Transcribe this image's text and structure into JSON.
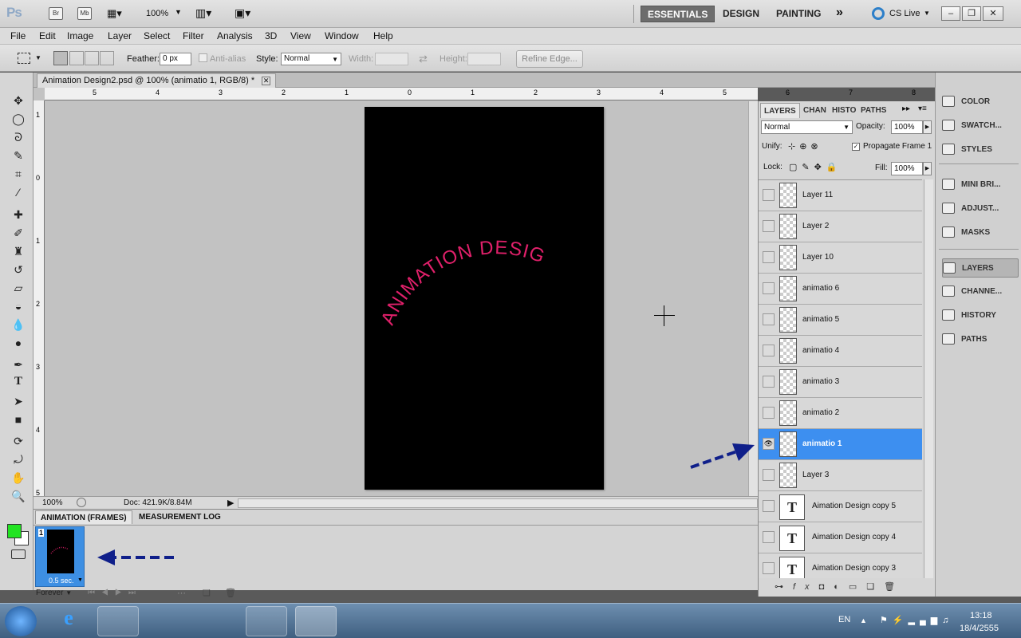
{
  "appbar": {
    "logo": "Ps",
    "bridge": "Br",
    "minibridge": "Mb",
    "zoom": "100%",
    "workspaces": [
      "ESSENTIALS",
      "DESIGN",
      "PAINTING"
    ],
    "more": "»",
    "cslive": "CS Live"
  },
  "menu": [
    "File",
    "Edit",
    "Image",
    "Layer",
    "Select",
    "Filter",
    "Analysis",
    "3D",
    "View",
    "Window",
    "Help"
  ],
  "options": {
    "feather_label": "Feather:",
    "feather_value": "0 px",
    "antialias_label": "Anti-alias",
    "style_label": "Style:",
    "style_value": "Normal",
    "width_label": "Width:",
    "height_label": "Height:",
    "refine_edge": "Refine Edge..."
  },
  "document": {
    "tab_title": "Animation Design2.psd @ 100% (animatio 1, RGB/8) *",
    "artwork_text": "ANIMATION DESIGN",
    "artwork_color": "#e0206a",
    "zoom": "100%",
    "doc_info": "Doc: 421.9K/8.84M",
    "ruler_top": [
      "5",
      "4",
      "3",
      "2",
      "1",
      "0",
      "1",
      "2",
      "3",
      "4",
      "5",
      "6",
      "7",
      "8"
    ],
    "ruler_left": [
      "1",
      "0",
      "1",
      "2",
      "3",
      "4",
      "5"
    ]
  },
  "animation_panel": {
    "tabs": [
      "ANIMATION (FRAMES)",
      "MEASUREMENT LOG"
    ],
    "frame_number": "1",
    "frame_delay": "0.5 sec.",
    "loop": "Forever"
  },
  "layers_panel": {
    "tabs": [
      "LAYERS",
      "CHAN",
      "HISTO",
      "PATHS"
    ],
    "blend_mode": "Normal",
    "opacity_label": "Opacity:",
    "opacity": "100%",
    "unify_label": "Unify:",
    "propagate": "Propagate Frame 1",
    "lock_label": "Lock:",
    "fill_label": "Fill:",
    "fill": "100%",
    "layers": [
      {
        "name": "Layer 11",
        "type": "pixel",
        "visible": false,
        "selected": false
      },
      {
        "name": "Layer 2",
        "type": "pixel",
        "visible": false,
        "selected": false
      },
      {
        "name": "Layer 10",
        "type": "pixel",
        "visible": false,
        "selected": false
      },
      {
        "name": "animatio 6",
        "type": "pixel",
        "visible": false,
        "selected": false
      },
      {
        "name": "animatio 5",
        "type": "pixel",
        "visible": false,
        "selected": false
      },
      {
        "name": "animatio 4",
        "type": "pixel",
        "visible": false,
        "selected": false
      },
      {
        "name": "animatio 3",
        "type": "pixel",
        "visible": false,
        "selected": false
      },
      {
        "name": "animatio 2",
        "type": "pixel",
        "visible": false,
        "selected": false
      },
      {
        "name": "animatio 1",
        "type": "pixel",
        "visible": true,
        "selected": true
      },
      {
        "name": "Layer 3",
        "type": "pixel",
        "visible": false,
        "selected": false
      },
      {
        "name": "Aimation   Design copy 5",
        "type": "text",
        "visible": false,
        "selected": false
      },
      {
        "name": "Aimation   Design copy 4",
        "type": "text",
        "visible": false,
        "selected": false
      },
      {
        "name": "Aimation   Design copy 3",
        "type": "text",
        "visible": false,
        "selected": false
      }
    ]
  },
  "dock": {
    "group1": [
      "COLOR",
      "SWATCH...",
      "STYLES"
    ],
    "group2": [
      "MINI BRI...",
      "ADJUST...",
      "MASKS"
    ],
    "group3": [
      "LAYERS",
      "CHANNE...",
      "HISTORY",
      "PATHS"
    ]
  },
  "colors": {
    "foreground": "#22e322",
    "background": "#ffffff",
    "selection": "#3d8ff0"
  },
  "taskbar": {
    "lang": "EN",
    "time": "13:18",
    "date": "18/4/2555"
  }
}
